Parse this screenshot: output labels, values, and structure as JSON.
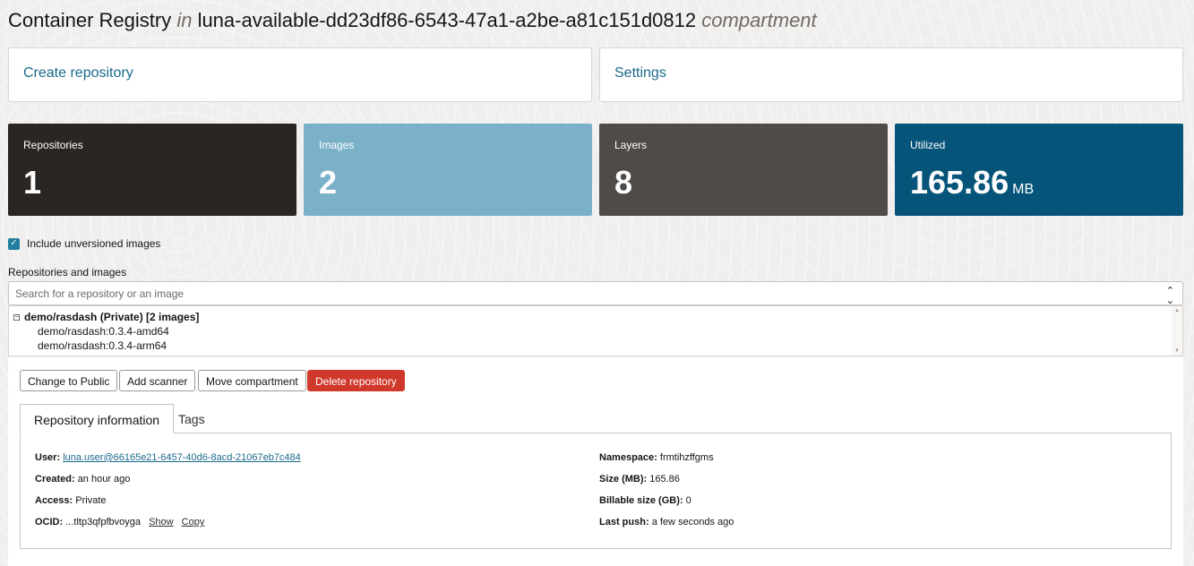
{
  "header": {
    "title": "Container Registry",
    "in": "in",
    "compartment_name": "luna-available-dd23df86-6543-47a1-a2be-a81c151d0812",
    "compartment_word": "compartment"
  },
  "actions": {
    "create": "Create repository",
    "settings": "Settings"
  },
  "metrics": [
    {
      "label": "Repositories",
      "value": "1",
      "unit": "",
      "color": "#2a2624"
    },
    {
      "label": "Images",
      "value": "2",
      "unit": "",
      "color": "#7ab1c9"
    },
    {
      "label": "Layers",
      "value": "8",
      "unit": "",
      "color": "#504b47"
    },
    {
      "label": "Utilized",
      "value": "165.86",
      "unit": "MB",
      "color": "#06547a"
    }
  ],
  "filters": {
    "include_unversioned_label": "Include unversioned images",
    "include_unversioned_checked": true
  },
  "search": {
    "section_label": "Repositories and images",
    "placeholder": "Search for a repository or an image",
    "value": ""
  },
  "tree": {
    "group_label": "demo/rasdash (Private) [2 images]",
    "items": [
      "demo/rasdash:0.3.4-amd64",
      "demo/rasdash:0.3.4-arm64"
    ]
  },
  "repo_actions": {
    "change_public": "Change to Public",
    "add_scanner": "Add scanner",
    "move_compartment": "Move compartment",
    "delete": "Delete repository",
    "danger_color": "#d1382c"
  },
  "tabs": [
    {
      "label": "Repository information",
      "active": true
    },
    {
      "label": "Tags",
      "active": false
    }
  ],
  "info": {
    "user_label": "User:",
    "user_value": "luna.user@66165e21-6457-40d6-8acd-21067eb7c484",
    "created_label": "Created:",
    "created_value": "an hour ago",
    "access_label": "Access:",
    "access_value": "Private",
    "ocid_label": "OCID:",
    "ocid_value": "...tltp3qfpfbvoyga",
    "ocid_show": "Show",
    "ocid_copy": "Copy",
    "namespace_label": "Namespace:",
    "namespace_value": "frmtihzffgms",
    "size_label": "Size (MB):",
    "size_value": "165.86",
    "billable_label": "Billable size (GB):",
    "billable_value": "0",
    "last_push_label": "Last push:",
    "last_push_value": "a few seconds ago"
  }
}
